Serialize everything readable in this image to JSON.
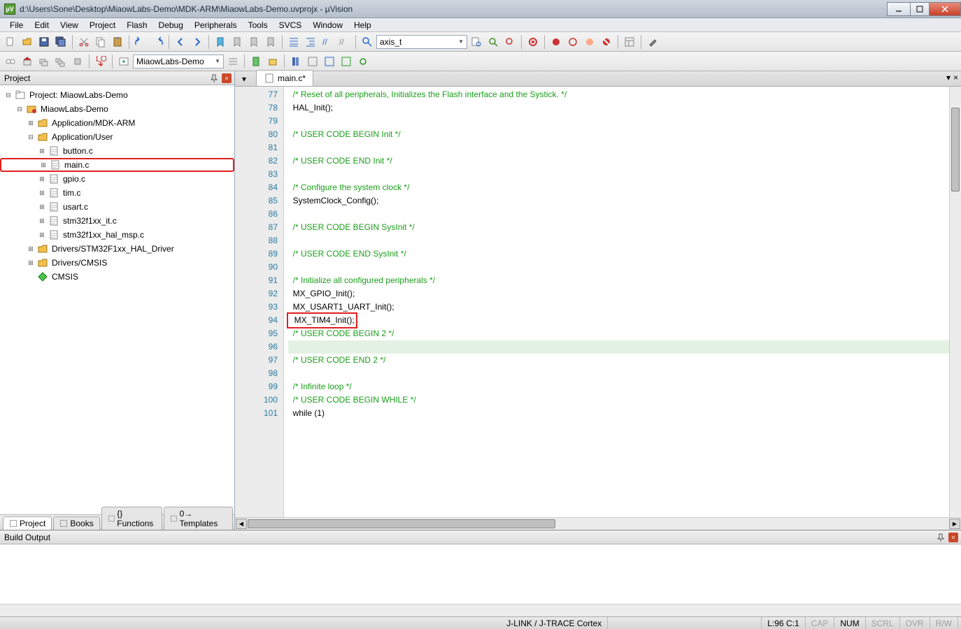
{
  "window": {
    "title": "d:\\Users\\Sone\\Desktop\\MiaowLabs-Demo\\MDK-ARM\\MiaowLabs-Demo.uvprojx - µVision",
    "logo": "µV"
  },
  "menu": [
    "File",
    "Edit",
    "View",
    "Project",
    "Flash",
    "Debug",
    "Peripherals",
    "Tools",
    "SVCS",
    "Window",
    "Help"
  ],
  "toolbar1": {
    "combo": "axis_t"
  },
  "toolbar2": {
    "target": "MiaowLabs-Demo"
  },
  "project_panel": {
    "title": "Project",
    "tree": [
      {
        "indent": 0,
        "twisty": "-",
        "icon": "workspace",
        "label": "Project: MiaowLabs-Demo"
      },
      {
        "indent": 1,
        "twisty": "-",
        "icon": "target",
        "label": "MiaowLabs-Demo"
      },
      {
        "indent": 2,
        "twisty": "+",
        "icon": "folder",
        "label": "Application/MDK-ARM"
      },
      {
        "indent": 2,
        "twisty": "-",
        "icon": "folder",
        "label": "Application/User"
      },
      {
        "indent": 3,
        "twisty": "+",
        "icon": "cfile",
        "label": "button.c"
      },
      {
        "indent": 3,
        "twisty": "+",
        "icon": "cfile",
        "label": "main.c",
        "highlight": true
      },
      {
        "indent": 3,
        "twisty": "+",
        "icon": "cfile",
        "label": "gpio.c"
      },
      {
        "indent": 3,
        "twisty": "+",
        "icon": "cfile",
        "label": "tim.c"
      },
      {
        "indent": 3,
        "twisty": "+",
        "icon": "cfile",
        "label": "usart.c"
      },
      {
        "indent": 3,
        "twisty": "+",
        "icon": "cfile",
        "label": "stm32f1xx_it.c"
      },
      {
        "indent": 3,
        "twisty": "+",
        "icon": "cfile",
        "label": "stm32f1xx_hal_msp.c"
      },
      {
        "indent": 2,
        "twisty": "+",
        "icon": "folder",
        "label": "Drivers/STM32F1xx_HAL_Driver"
      },
      {
        "indent": 2,
        "twisty": "+",
        "icon": "folder",
        "label": "Drivers/CMSIS"
      },
      {
        "indent": 2,
        "twisty": "",
        "icon": "diamond",
        "label": "CMSIS"
      }
    ],
    "bottom_tabs": [
      {
        "icon": "proj",
        "label": "Project",
        "active": true
      },
      {
        "icon": "books",
        "label": "Books"
      },
      {
        "icon": "func",
        "label": "{} Functions"
      },
      {
        "icon": "tmpl",
        "label": "0→ Templates"
      }
    ]
  },
  "editor": {
    "tab": "main.c*",
    "first_line": 77,
    "lines": [
      {
        "n": 77,
        "t": "  /* Reset of all peripherals, Initializes the Flash interface and the Systick. */",
        "cls": "comment"
      },
      {
        "n": 78,
        "t": "  HAL_Init();"
      },
      {
        "n": 79,
        "t": ""
      },
      {
        "n": 80,
        "t": "  /* USER CODE BEGIN Init */",
        "cls": "comment"
      },
      {
        "n": 81,
        "t": ""
      },
      {
        "n": 82,
        "t": "  /* USER CODE END Init */",
        "cls": "comment"
      },
      {
        "n": 83,
        "t": ""
      },
      {
        "n": 84,
        "t": "  /* Configure the system clock */",
        "cls": "comment"
      },
      {
        "n": 85,
        "t": "  SystemClock_Config();"
      },
      {
        "n": 86,
        "t": ""
      },
      {
        "n": 87,
        "t": "  /* USER CODE BEGIN SysInit */",
        "cls": "comment"
      },
      {
        "n": 88,
        "t": ""
      },
      {
        "n": 89,
        "t": "  /* USER CODE END SysInit */",
        "cls": "comment"
      },
      {
        "n": 90,
        "t": ""
      },
      {
        "n": 91,
        "t": "  /* Initialize all configured peripherals */",
        "cls": "comment"
      },
      {
        "n": 92,
        "t": "  MX_GPIO_Init();"
      },
      {
        "n": 93,
        "t": "  MX_USART1_UART_Init();"
      },
      {
        "n": 94,
        "t": "  MX_TIM4_Init();",
        "hl": true
      },
      {
        "n": 95,
        "t": "  /* USER CODE BEGIN 2 */",
        "cls": "comment"
      },
      {
        "n": 96,
        "t": "",
        "current": true
      },
      {
        "n": 97,
        "t": "  /* USER CODE END 2 */",
        "cls": "comment"
      },
      {
        "n": 98,
        "t": ""
      },
      {
        "n": 99,
        "t": "  /* Infinite loop */",
        "cls": "comment"
      },
      {
        "n": 100,
        "t": "  /* USER CODE BEGIN WHILE */",
        "cls": "comment"
      },
      {
        "n": 101,
        "t": "  while (1)"
      }
    ]
  },
  "build_output": {
    "title": "Build Output"
  },
  "statusbar": {
    "debugger": "J-LINK / J-TRACE Cortex",
    "cursor": "L:96 C:1",
    "caps": "CAP",
    "num": "NUM",
    "scrl": "SCRL",
    "ovr": "OVR",
    "rw": "R/W"
  }
}
